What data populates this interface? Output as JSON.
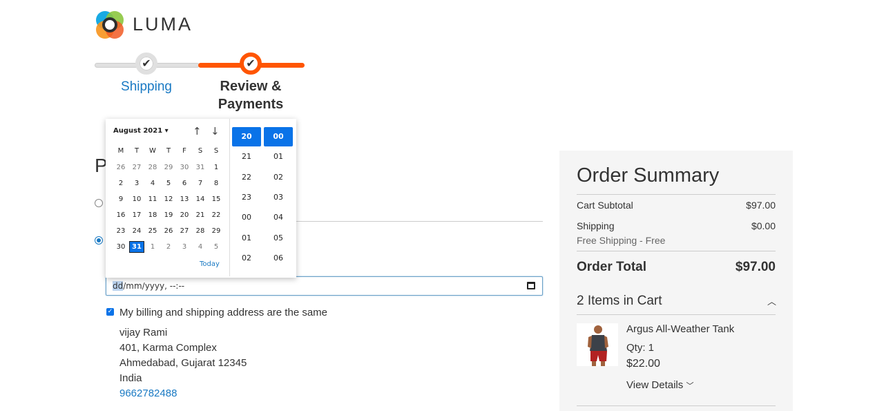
{
  "brand": {
    "name": "LUMA"
  },
  "progress": {
    "steps": [
      {
        "label": "Shipping",
        "state": "completed"
      },
      {
        "label": "Review & Payments",
        "state": "active"
      }
    ],
    "accent_color": "#ff5501"
  },
  "payment": {
    "heading": "P"
  },
  "datetime_input": {
    "day_placeholder": "dd",
    "rest_placeholder": "/mm/yyyy, --:--"
  },
  "datepicker": {
    "month_label": "August 2021 ▾",
    "weekdays": [
      "M",
      "T",
      "W",
      "T",
      "F",
      "S",
      "S"
    ],
    "weeks": [
      [
        "26",
        "27",
        "28",
        "29",
        "30",
        "31",
        "1"
      ],
      [
        "2",
        "3",
        "4",
        "5",
        "6",
        "7",
        "8"
      ],
      [
        "9",
        "10",
        "11",
        "12",
        "13",
        "14",
        "15"
      ],
      [
        "16",
        "17",
        "18",
        "19",
        "20",
        "21",
        "22"
      ],
      [
        "23",
        "24",
        "25",
        "26",
        "27",
        "28",
        "29"
      ],
      [
        "30",
        "31",
        "1",
        "2",
        "3",
        "4",
        "5"
      ]
    ],
    "selected_day": "31",
    "today_label": "Today",
    "hours": [
      "20",
      "21",
      "22",
      "23",
      "00",
      "01",
      "02"
    ],
    "minutes": [
      "00",
      "01",
      "02",
      "03",
      "04",
      "05",
      "06"
    ],
    "selected_hour": "20",
    "selected_minute": "00"
  },
  "billing": {
    "same_address_label": "My billing and shipping address are the same",
    "same_address_checked": true,
    "address_lines": [
      "vijay Rami",
      "401, Karma Complex",
      "Ahmedabad, Gujarat 12345",
      "India"
    ],
    "phone": "9662782488"
  },
  "order_summary": {
    "title": "Order Summary",
    "cart_subtotal_label": "Cart Subtotal",
    "cart_subtotal_value": "$97.00",
    "shipping_label": "Shipping",
    "shipping_value": "$0.00",
    "shipping_method": "Free Shipping - Free",
    "order_total_label": "Order Total",
    "order_total_value": "$97.00",
    "items_in_cart_label": "2 Items in Cart",
    "item": {
      "name": "Argus All-Weather Tank",
      "qty_label": "Qty: 1",
      "price": "$22.00",
      "view_details_label": "View Details"
    }
  }
}
